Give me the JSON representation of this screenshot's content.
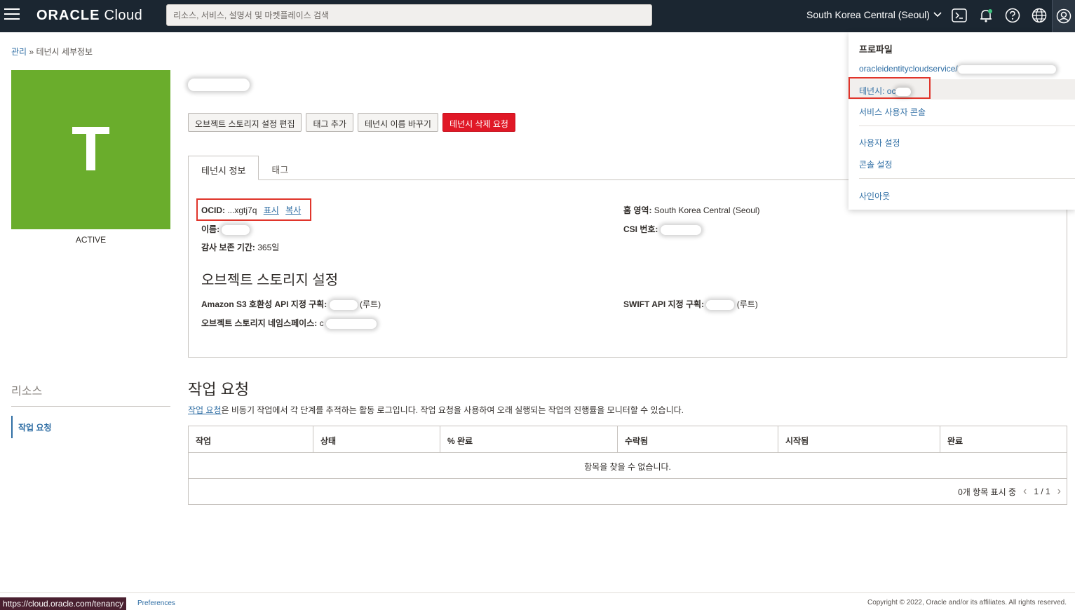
{
  "header": {
    "brand_bold": "ORACLE",
    "brand_light": "Cloud",
    "search_placeholder": "리소스, 서비스, 설명서 및 마켓플레이스 검색",
    "region": "South Korea Central (Seoul)"
  },
  "breadcrumb": {
    "parent": "관리",
    "separator": "»",
    "current": "테넌시 세부정보"
  },
  "tenancy": {
    "tile_letter": "T",
    "status": "ACTIVE",
    "tile_color": "#6aad2c"
  },
  "actions": {
    "edit_storage": "오브젝트 스토리지 설정 편집",
    "add_tag": "태그 추가",
    "rename": "테넌시 이름 바꾸기",
    "delete": "테넌시 삭제 요청"
  },
  "tabs": {
    "info": "테넌시 정보",
    "tags": "태그"
  },
  "info": {
    "ocid_label": "OCID:",
    "ocid_value": "...xgtj7q",
    "show": "표시",
    "copy": "복사",
    "name_label": "이름:",
    "audit_label": "감사 보존 기간:",
    "audit_value": "365일",
    "home_label": "홈 영역:",
    "home_value": "South Korea Central (Seoul)",
    "csi_label": "CSI 번호:"
  },
  "storage": {
    "title": "오브젝트 스토리지 설정",
    "s3_label": "Amazon S3 호환성 API 지정 구획:",
    "s3_suffix": "(루트)",
    "namespace_label": "오브젝트 스토리지 네임스페이스:",
    "namespace_prefix": "c",
    "swift_label": "SWIFT API 지정 구획:",
    "swift_suffix": "(루트)"
  },
  "resources": {
    "title": "리소스",
    "item": "작업 요청"
  },
  "work_requests": {
    "title": "작업 요청",
    "desc_link": "작업 요청",
    "desc_rest": "은 비동기 작업에서 각 단계를 추적하는 활동 로그입니다. 작업 요청을 사용하여 오래 실행되는 작업의 진행률을 모니터할 수 있습니다.",
    "columns": [
      "작업",
      "상태",
      "% 완료",
      "수락됨",
      "시작됨",
      "완료"
    ],
    "empty": "항목을 찾을 수 없습니다.",
    "count": "0개 항목 표시 중",
    "page": "1 / 1"
  },
  "profile_menu": {
    "heading": "프로파일",
    "identity": "oracleidentitycloudservice/",
    "tenancy": "테넌시: oc",
    "service_console": "서비스 사용자 콘솔",
    "user_settings": "사용자 설정",
    "console_settings": "콘솔 설정",
    "sign_out": "사인아웃"
  },
  "footer": {
    "status_url": "https://cloud.oracle.com/tenancy",
    "preferences": "Preferences",
    "copyright": "Copyright © 2022, Oracle and/or its affiliates. All rights reserved."
  }
}
